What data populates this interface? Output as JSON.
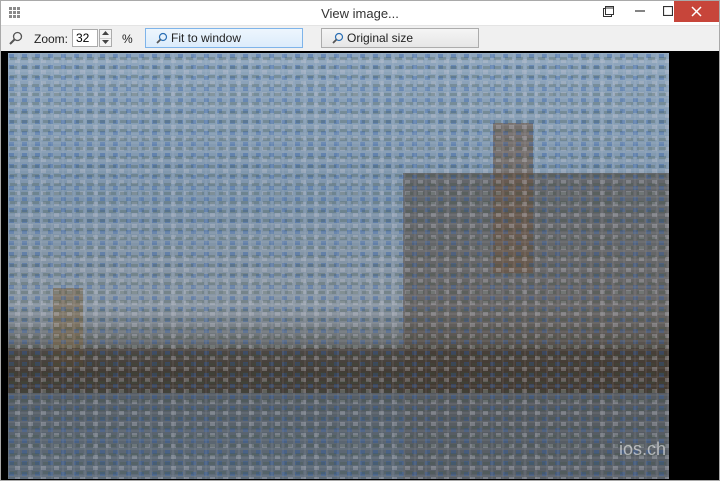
{
  "window": {
    "title": "View image..."
  },
  "toolbar": {
    "zoom_label": "Zoom:",
    "zoom_value": "32",
    "percent_label": "%",
    "fit_label": "Fit to window",
    "original_label": "Original size"
  },
  "image": {
    "description_icon": "photo-mosaic",
    "watermark_text": "ios.ch"
  },
  "icons": {
    "app": "grid-app-icon",
    "zoom": "magnifier-icon",
    "fit": "magnifier-fit-icon",
    "original": "magnifier-original-icon"
  },
  "colors": {
    "close_button": "#c7453a",
    "fit_button_border": "#7eb4ea",
    "image_background": "#000000"
  }
}
